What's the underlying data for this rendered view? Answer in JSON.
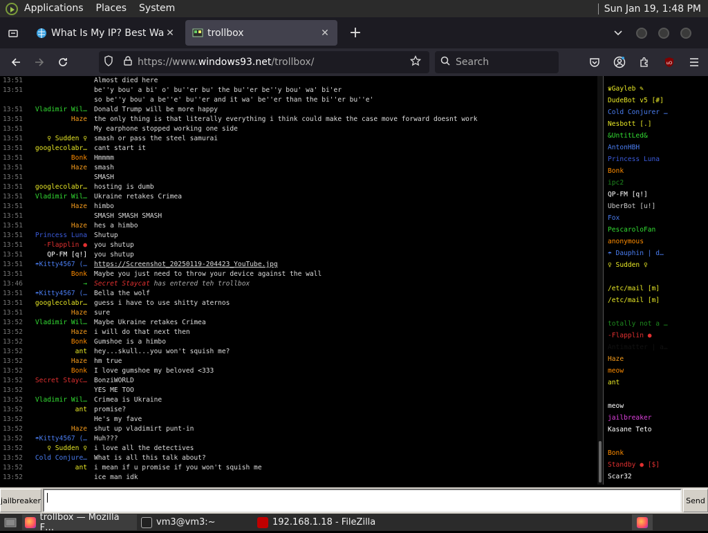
{
  "top_panel": {
    "menus": [
      "Applications",
      "Places",
      "System"
    ],
    "clock": "Sun Jan 19,  1:48 PM"
  },
  "tabs": [
    {
      "title": "What Is My IP? Best Way To",
      "active": false,
      "icon": "globe-icon"
    },
    {
      "title": "trollbox",
      "active": true,
      "icon": "trollbox-icon"
    }
  ],
  "nav": {
    "url_host": "https://www.",
    "url_domain": "windows93.net",
    "url_path": "/trollbox/",
    "search_placeholder": "Search"
  },
  "messages": [
    {
      "t": "13:51",
      "n": "",
      "nc": "#1a3cdd",
      "c": "Almost died here"
    },
    {
      "t": "13:51",
      "n": "",
      "nc": "#1a3cdd",
      "c": "be''y bou' a bi' o' bu''er bu' the bu''er be''y bou' wa' bi'er"
    },
    {
      "t": "",
      "n": "",
      "nc": "#1a3cdd",
      "c": "so be''y bou' a be''e' bu''er and it wa' be''er than the bi''er bu''e'"
    },
    {
      "t": "13:51",
      "n": "Vladimir Wil…",
      "nc": "#33dd33",
      "c": "Donald Trump will be more happy"
    },
    {
      "t": "13:51",
      "n": "Haze",
      "nc": "#f59b1c",
      "c": "the only thing is that literally everything i think could make the case move forward doesnt work"
    },
    {
      "t": "13:51",
      "n": "",
      "nc": "#1a3cdd",
      "c": "My earphone stopped working one side"
    },
    {
      "t": "13:51",
      "n": "♀ Sudden ♀",
      "nc": "#e8e826",
      "c": "smash or pass the steel samurai"
    },
    {
      "t": "13:51",
      "n": "googlecolabr…",
      "nc": "#e8e826",
      "c": "cant start it"
    },
    {
      "t": "13:51",
      "n": "Bonk",
      "nc": "#ff8c00",
      "c": "Hmmmm"
    },
    {
      "t": "13:51",
      "n": "Haze",
      "nc": "#f59b1c",
      "c": "smash"
    },
    {
      "t": "13:51",
      "n": "",
      "nc": "#1a3cdd",
      "c": "SMASH"
    },
    {
      "t": "13:51",
      "n": "googlecolabr…",
      "nc": "#e8e826",
      "c": "hosting is dumb"
    },
    {
      "t": "13:51",
      "n": "Vladimir Wil…",
      "nc": "#33dd33",
      "c": "Ukraine retakes Crimea"
    },
    {
      "t": "13:51",
      "n": "Haze",
      "nc": "#f59b1c",
      "c": "himbo"
    },
    {
      "t": "13:51",
      "n": "",
      "nc": "#1a3cdd",
      "c": "SMASH SMASH SMASH"
    },
    {
      "t": "13:51",
      "n": "Haze",
      "nc": "#f59b1c",
      "c": "hes a himbo"
    },
    {
      "t": "13:51",
      "n": "Princess Luna",
      "nc": "#3b5bdb",
      "c": "Shutup"
    },
    {
      "t": "13:51",
      "n": "-Flapplin ●",
      "nc": "#e03030",
      "c": "you shutup"
    },
    {
      "t": "13:51",
      "n": "QP-FM [q!]",
      "nc": "#ffffff",
      "c": "you shutup"
    },
    {
      "t": "13:51",
      "n": "☂Kitty4567 (…",
      "nc": "#4a7df0",
      "c": "https://Screenshot_20250119-204423_YouTube.jpg",
      "link": true
    },
    {
      "t": "13:51",
      "n": "Bonk",
      "nc": "#ff8c00",
      "c": "Maybe you just need to throw your device against the wall"
    },
    {
      "t": "13:46",
      "n": "→",
      "nc": "#33dd33",
      "c": "has entered teh trollbox",
      "sys": true,
      "who": "Secret Staycat"
    },
    {
      "t": "13:51",
      "n": "☂Kitty4567 (…",
      "nc": "#4a7df0",
      "c": "Bella the wolf"
    },
    {
      "t": "13:51",
      "n": "googlecolabr…",
      "nc": "#e8e826",
      "c": "guess i have to use shitty aternos"
    },
    {
      "t": "13:51",
      "n": "Haze",
      "nc": "#f59b1c",
      "c": "sure"
    },
    {
      "t": "13:52",
      "n": "Vladimir Wil…",
      "nc": "#33dd33",
      "c": "Maybe Ukraine retakes Crimea"
    },
    {
      "t": "13:52",
      "n": "Haze",
      "nc": "#f59b1c",
      "c": "i will do that next then"
    },
    {
      "t": "13:52",
      "n": "Bonk",
      "nc": "#ff8c00",
      "c": "Gumshoe is a himbo"
    },
    {
      "t": "13:52",
      "n": "ant",
      "nc": "#e8e826",
      "c": "hey...skull...you won't squish me?"
    },
    {
      "t": "13:52",
      "n": "Haze",
      "nc": "#f59b1c",
      "c": "hm true"
    },
    {
      "t": "13:52",
      "n": "Bonk",
      "nc": "#ff8c00",
      "c": "I love gumshoe my beloved <333"
    },
    {
      "t": "13:52",
      "n": "Secret Stayc…",
      "nc": "#e03030",
      "c": "BonziWORLD"
    },
    {
      "t": "13:52",
      "n": "",
      "nc": "#1a3cdd",
      "c": "YES ME TOO"
    },
    {
      "t": "13:52",
      "n": "Vladimir Wil…",
      "nc": "#33dd33",
      "c": "Crimea is Ukraine"
    },
    {
      "t": "13:52",
      "n": "ant",
      "nc": "#e8e826",
      "c": "promise?"
    },
    {
      "t": "13:52",
      "n": "",
      "nc": "#1a3cdd",
      "c": "He's my fave"
    },
    {
      "t": "13:52",
      "n": "Haze",
      "nc": "#f59b1c",
      "c": "shut up vladimirt punt-in"
    },
    {
      "t": "13:52",
      "n": "☂Kitty4567 (…",
      "nc": "#4a7df0",
      "c": "Huh???"
    },
    {
      "t": "13:52",
      "n": "♀ Sudden ♀",
      "nc": "#e8e826",
      "c": "i love all the detectives"
    },
    {
      "t": "13:52",
      "n": "Cold Conjure…",
      "nc": "#4a7df0",
      "c": "What is all this talk about?"
    },
    {
      "t": "13:52",
      "n": "ant",
      "nc": "#e8e826",
      "c": "i mean if u promise if you won't squish me"
    },
    {
      "t": "13:52",
      "n": "",
      "nc": "#1a3cdd",
      "c": "ice man idk"
    }
  ],
  "users": [
    {
      "n": "♛Gayleb ✎",
      "c": "#e8e826"
    },
    {
      "n": "DudeBot v5 [#]",
      "c": "#e8e826"
    },
    {
      "n": "Cold Conjurer …",
      "c": "#4a7df0"
    },
    {
      "n": "Nesbott [.]",
      "c": "#e8e826"
    },
    {
      "n": "&UntitLed&",
      "c": "#33dd33"
    },
    {
      "n": "AntonHBH",
      "c": "#4a7df0"
    },
    {
      "n": "Princess Luna",
      "c": "#3b5bdb"
    },
    {
      "n": "Bonk",
      "c": "#ff8c00"
    },
    {
      "n": "ipc2",
      "c": "#1e8a1e"
    },
    {
      "n": "QP-FM [q!]",
      "c": "#ffffff"
    },
    {
      "n": "UberBot [u!]",
      "c": "#cccccc"
    },
    {
      "n": "Fox",
      "c": "#4a7df0"
    },
    {
      "n": "PescaroloFan",
      "c": "#33dd33"
    },
    {
      "n": "anonymous",
      "c": "#ff8c00"
    },
    {
      "n": "☂ Dauphin | d…",
      "c": "#4a7df0"
    },
    {
      "n": "♀ Sudden ♀",
      "c": "#e8e826"
    },
    {
      "n": "",
      "c": "#1a3cdd"
    },
    {
      "n": "/etc/mail [m]",
      "c": "#e8e826"
    },
    {
      "n": "/etc/mail [m]",
      "c": "#e8e826"
    },
    {
      "n": "",
      "c": "#1a3cdd"
    },
    {
      "n": "totally not a …",
      "c": "#1e8a1e"
    },
    {
      "n": "-Flapplin ●",
      "c": "#e03030"
    },
    {
      "n": "Antimatter | a…",
      "c": "#111111"
    },
    {
      "n": "Haze",
      "c": "#f59b1c"
    },
    {
      "n": "meow",
      "c": "#ff8c00"
    },
    {
      "n": "ant",
      "c": "#e8e826"
    },
    {
      "n": "",
      "c": "#1a3cdd"
    },
    {
      "n": "meow",
      "c": "#ffffff"
    },
    {
      "n": "jailbreaker",
      "c": "#e040e0"
    },
    {
      "n": "Kasane Teto",
      "c": "#ffffff"
    },
    {
      "n": "",
      "c": "#1a3cdd"
    },
    {
      "n": "Bonk",
      "c": "#ff8c00"
    },
    {
      "n": "Standby ● [$]",
      "c": "#e03030"
    },
    {
      "n": "Scar32",
      "c": "#ffffff"
    }
  ],
  "input": {
    "nick": "jailbreaker",
    "value": "",
    "send_label": "Send"
  },
  "taskbar": [
    {
      "label": "trollbox — Mozilla F…",
      "active": true,
      "icon": "firefox-icon"
    },
    {
      "label": "vm3@vm3:~",
      "active": false,
      "icon": "terminal-icon"
    },
    {
      "label": "192.168.1.18 - FileZilla",
      "active": false,
      "icon": "filezilla-icon"
    }
  ]
}
